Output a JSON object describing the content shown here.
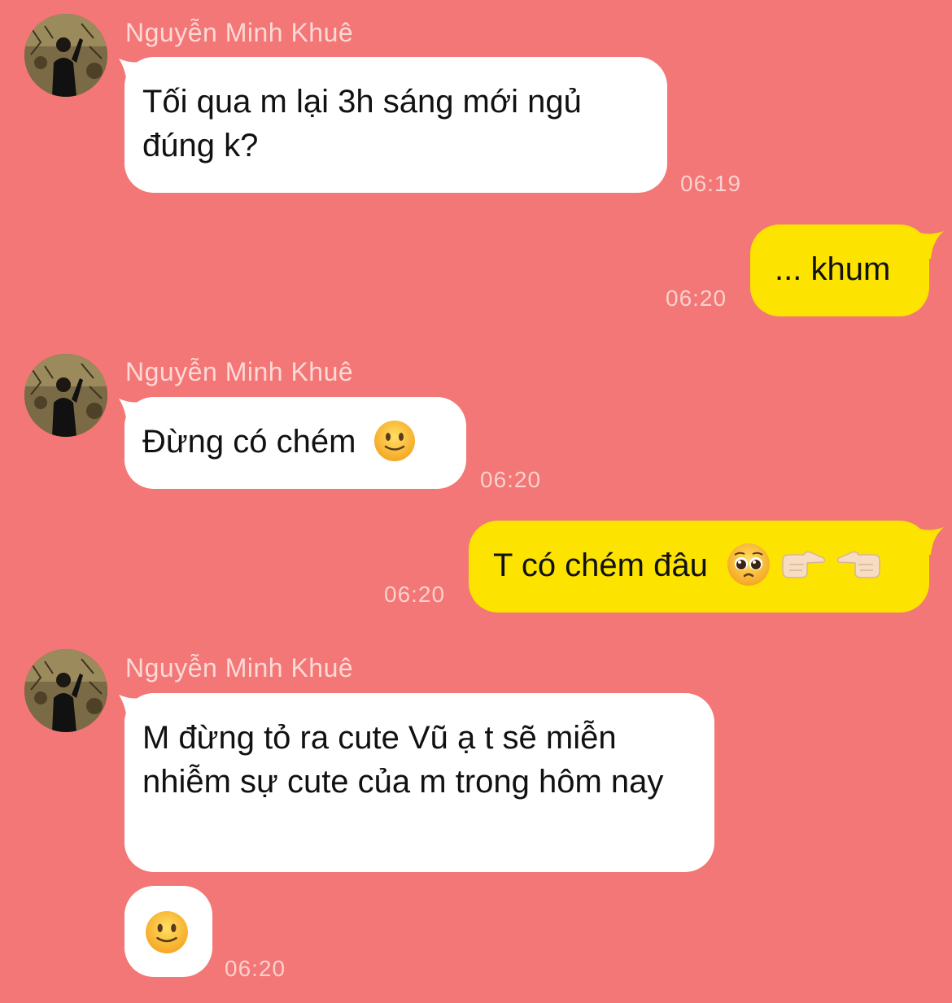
{
  "conversation": {
    "sender_name": "Nguyễn Minh Khuê",
    "messages": [
      {
        "from": "them",
        "text": "Tối qua m lại 3h sáng mới ngủ đúng k?",
        "time": "06:19"
      },
      {
        "from": "me",
        "text": "... khum",
        "time": "06:20"
      },
      {
        "from": "them",
        "text": "Đừng có chém",
        "emoji": "slightly-smiling-face",
        "time": "06:20"
      },
      {
        "from": "me",
        "text": "T có chém đâu",
        "emoji": [
          "pleading-face",
          "pointing-right-hand",
          "pointing-left-hand"
        ],
        "time": "06:20"
      },
      {
        "from": "them",
        "text": "M đừng tỏ ra cute Vũ ạ t sẽ miễn nhiễm sự cute của m trong hôm nay"
      },
      {
        "from": "them",
        "emoji": "slightly-smiling-face",
        "time": "06:20"
      }
    ]
  },
  "colors": {
    "background": "#f27776",
    "incoming_bubble": "#ffffff",
    "outgoing_bubble": "#fde300",
    "sender_name": "#ffd9d6",
    "timestamp": "#fbd1ce"
  }
}
